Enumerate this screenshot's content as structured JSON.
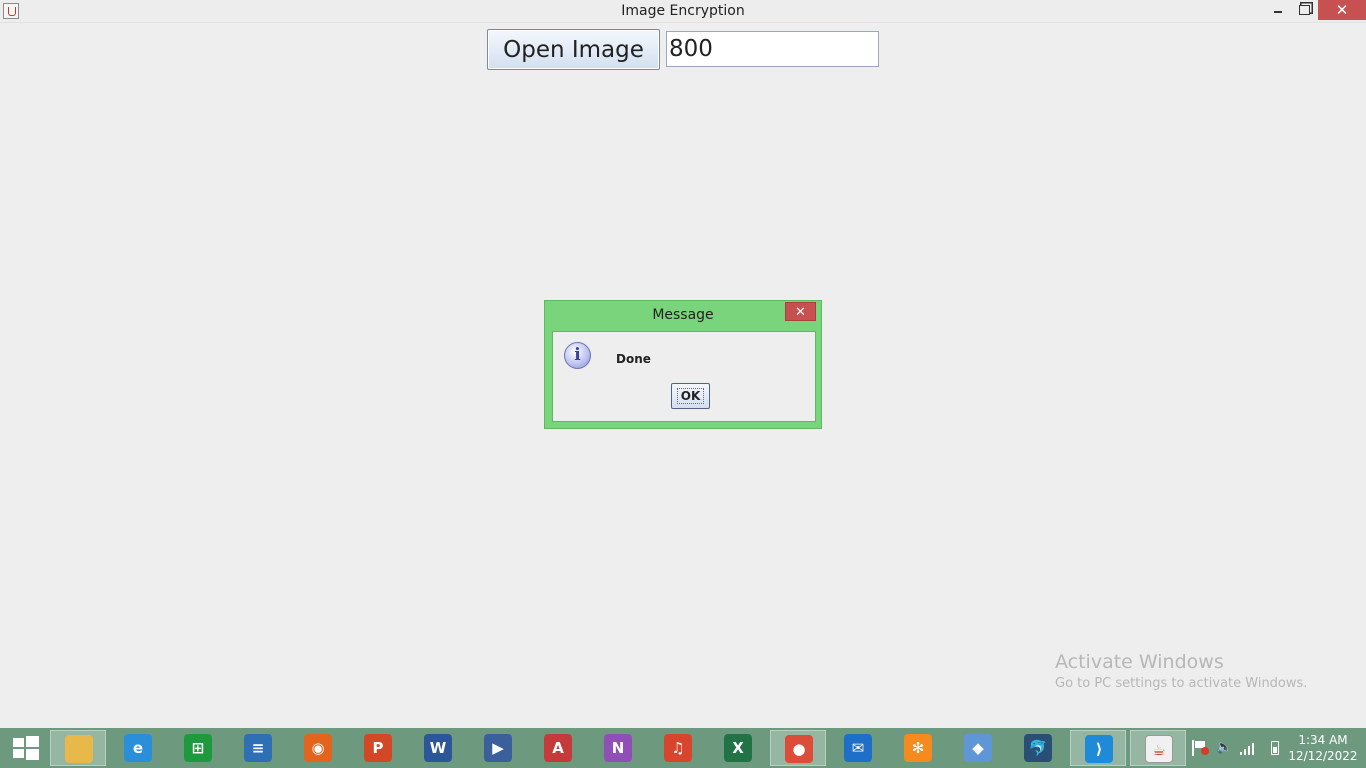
{
  "window": {
    "title": "Image Encryption",
    "close_glyph": "✕"
  },
  "toolbar": {
    "open_label": "Open Image",
    "value": "800"
  },
  "dialog": {
    "title": "Message",
    "close_glyph": "✕",
    "icon_glyph": "i",
    "message": "Done",
    "ok_label": "OK"
  },
  "watermark": {
    "title": "Activate Windows",
    "subtitle": "Go to PC settings to activate Windows."
  },
  "taskbar": {
    "apps": [
      {
        "icon": "file-explorer-icon",
        "glyph": "",
        "color": "#e8b84a"
      },
      {
        "icon": "internet-explorer-icon",
        "glyph": "e",
        "color": "#2a8fd8"
      },
      {
        "icon": "store-icon",
        "glyph": "⊞",
        "color": "#1d9a3d"
      },
      {
        "icon": "reader-icon",
        "glyph": "≡",
        "color": "#2f6fb3"
      },
      {
        "icon": "firefox-icon",
        "glyph": "◉",
        "color": "#e2641d"
      },
      {
        "icon": "powerpoint-icon",
        "glyph": "P",
        "color": "#d24726"
      },
      {
        "icon": "word-icon",
        "glyph": "W",
        "color": "#2b579a"
      },
      {
        "icon": "media-player-icon",
        "glyph": "▶",
        "color": "#3a5f9a"
      },
      {
        "icon": "acrobat-icon",
        "glyph": "A",
        "color": "#c53b3b"
      },
      {
        "icon": "onenote-icon",
        "glyph": "N",
        "color": "#8f4fb6"
      },
      {
        "icon": "music-icon",
        "glyph": "♫",
        "color": "#d8452d"
      },
      {
        "icon": "excel-icon",
        "glyph": "X",
        "color": "#217346"
      },
      {
        "icon": "chrome-icon",
        "glyph": "●",
        "color": "#dd4b39"
      },
      {
        "icon": "mail-icon",
        "glyph": "✉",
        "color": "#1e6fc8"
      },
      {
        "icon": "xampp-icon",
        "glyph": "✻",
        "color": "#f58a1f"
      },
      {
        "icon": "virtualbox-icon",
        "glyph": "◆",
        "color": "#5f97d6"
      },
      {
        "icon": "mysql-workbench-icon",
        "glyph": "🐬",
        "color": "#2a4f75"
      },
      {
        "icon": "vscode-icon",
        "glyph": "⟩",
        "color": "#1f8ad8"
      },
      {
        "icon": "java-icon",
        "glyph": "☕",
        "color": "#f0f0f0"
      }
    ],
    "clock_time": "1:34 AM",
    "clock_date": "12/12/2022"
  }
}
